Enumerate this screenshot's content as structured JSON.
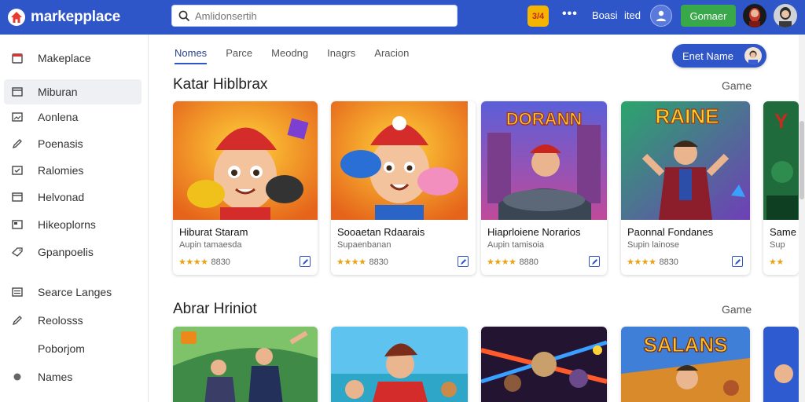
{
  "header": {
    "app_name": "markepplace",
    "search_placeholder": "Amlidonsertih",
    "badge_text": "3/4",
    "more_label": "•••",
    "link1": "Boasi",
    "link2": "ited",
    "green_button": "Gomaer"
  },
  "sidebar": {
    "items": [
      {
        "label": "Makeplace",
        "icon": "calendar-icon"
      },
      {
        "label": "Miburan",
        "icon": "window-icon"
      },
      {
        "label": "Aonlena",
        "icon": "image-icon"
      },
      {
        "label": "Poenasis",
        "icon": "pencil-icon"
      },
      {
        "label": "Ralomies",
        "icon": "checkbox-icon"
      },
      {
        "label": "Helvonad",
        "icon": "window-icon"
      },
      {
        "label": "Hikeoplorns",
        "icon": "window-icon"
      },
      {
        "label": "Gpanpoelis",
        "icon": "tag-icon"
      },
      {
        "label": "Searce Langes",
        "icon": "list-icon"
      },
      {
        "label": "Reolosss",
        "icon": "pencil-icon"
      },
      {
        "label": "Poborjom",
        "icon": ""
      },
      {
        "label": "Names",
        "icon": "circle-icon"
      }
    ]
  },
  "tabs": [
    {
      "label": "Nomes",
      "active": true
    },
    {
      "label": "Parce",
      "active": false
    },
    {
      "label": "Meodng",
      "active": false
    },
    {
      "label": "Inagrs",
      "active": false
    },
    {
      "label": "Aracion",
      "active": false
    }
  ],
  "create_button": "Enet Name",
  "sections": [
    {
      "title": "Katar Hiblbrax",
      "more": "Game",
      "cards": [
        {
          "title": "Hiburat Staram",
          "subtitle": "Aupin tamaesda",
          "stars": "★★★★",
          "rating": "8830"
        },
        {
          "title": "Sooaetan Rdaarais",
          "subtitle": "Supaenbanan",
          "stars": "★★★★",
          "rating": "8830"
        },
        {
          "title": "Hiaprloiene Norarios",
          "subtitle": "Aupin tamisoia",
          "stars": "★★★★",
          "rating": "8880"
        },
        {
          "title": "Paonnal Fondanes",
          "subtitle": "Supin lainose",
          "stars": "★★★★",
          "rating": "8830"
        },
        {
          "title": "Same",
          "subtitle": "Sup",
          "stars": "★★",
          "rating": ""
        }
      ]
    },
    {
      "title": "Abrar Hriniot",
      "more": "Game",
      "cards": [
        {
          "art": "adventure"
        },
        {
          "art": "boy"
        },
        {
          "art": "battle"
        },
        {
          "art": "salans",
          "logo": "SALANS"
        },
        {
          "art": "edge"
        }
      ]
    }
  ],
  "art_text": {
    "card3_logo": "DORANN",
    "card4_logo": "RAINE"
  },
  "colors": {
    "primary": "#2f56c8",
    "green": "#38a84b",
    "star": "#e8a317"
  }
}
